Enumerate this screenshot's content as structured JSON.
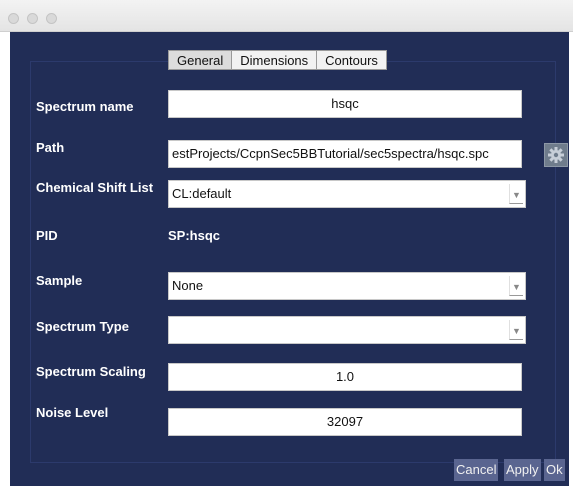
{
  "tabs": [
    "General",
    "Dimensions",
    "Contours"
  ],
  "labels": {
    "spectrum_name": "Spectrum name",
    "path": "Path",
    "chemical_shift_list": "Chemical Shift List",
    "pid": "PID",
    "sample": "Sample",
    "spectrum_type": "Spectrum Type",
    "spectrum_scaling": "Spectrum Scaling",
    "noise_level": "Noise Level"
  },
  "values": {
    "spectrum_name": "hsqc",
    "path": "estProjects/CcpnSec5BBTutorial/sec5spectra/hsqc.spc",
    "chemical_shift_list": "CL:default",
    "pid": "SP:hsqc",
    "sample": "None",
    "spectrum_type": "",
    "spectrum_scaling": "1.0",
    "noise_level": "32097"
  },
  "buttons": {
    "cancel": "Cancel",
    "apply": "Apply",
    "ok": "Ok"
  },
  "icons": {
    "path_browse": "gear-icon",
    "combo_arrow": "chevron-down-icon"
  }
}
